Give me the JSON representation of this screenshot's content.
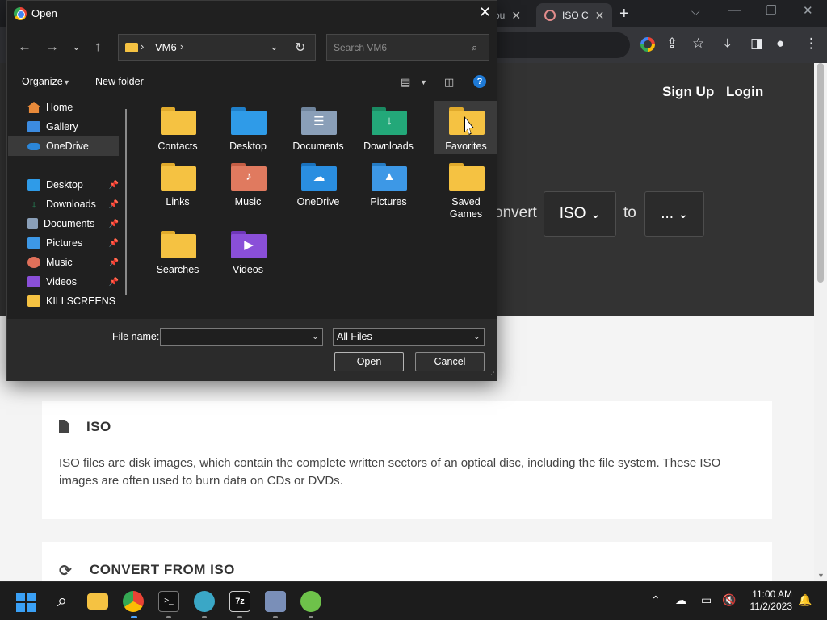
{
  "browser": {
    "tabs": [
      {
        "title": "ou"
      },
      {
        "title": "ISO C"
      }
    ],
    "site": {
      "signup": "Sign Up",
      "login": "Login",
      "convert_word": "onvert",
      "from_format": "ISO",
      "to_word": "to",
      "to_format": "..."
    },
    "cards": [
      {
        "title": "ISO",
        "text": "ISO files are disk images, which contain the complete written sectors of an optical disc, including the file system. These ISO images are often used to burn data on CDs or DVDs."
      },
      {
        "title": "CONVERT FROM ISO"
      }
    ]
  },
  "dialog": {
    "title": "Open",
    "address": {
      "segment": "VM6"
    },
    "search_placeholder": "Search VM6",
    "commands": {
      "organize": "Organize",
      "new_folder": "New folder"
    },
    "nav": [
      {
        "label": "Home",
        "icon": "home-icon",
        "color": "#e88a3a",
        "pinned": false,
        "selected": false
      },
      {
        "label": "Gallery",
        "icon": "gallery-icon",
        "color": "#3c8be0",
        "pinned": false,
        "selected": false
      },
      {
        "label": "OneDrive",
        "icon": "onedrive-icon",
        "color": "#2b86d9",
        "pinned": false,
        "selected": true
      },
      {
        "label": "Desktop",
        "icon": "desktop-icon",
        "color": "#2f9be8",
        "pinned": true,
        "selected": false
      },
      {
        "label": "Downloads",
        "icon": "downloads-icon",
        "color": "#28a86b",
        "pinned": true,
        "selected": false
      },
      {
        "label": "Documents",
        "icon": "documents-icon",
        "color": "#8a9fb8",
        "pinned": true,
        "selected": false
      },
      {
        "label": "Pictures",
        "icon": "pictures-icon",
        "color": "#3d98e6",
        "pinned": true,
        "selected": false
      },
      {
        "label": "Music",
        "icon": "music-icon",
        "color": "#e0705a",
        "pinned": true,
        "selected": false
      },
      {
        "label": "Videos",
        "icon": "videos-icon",
        "color": "#8a4fd8",
        "pinned": true,
        "selected": false
      },
      {
        "label": "KILLSCREENS",
        "icon": "folder-icon",
        "color": "#f5c242",
        "pinned": false,
        "selected": false
      }
    ],
    "files": [
      {
        "label": "Contacts",
        "icon": "contacts-folder-icon",
        "color": "#f5c242",
        "glyph": ""
      },
      {
        "label": "Desktop",
        "icon": "desktop-folder-icon",
        "color": "#2f9be8",
        "glyph": ""
      },
      {
        "label": "Documents",
        "icon": "documents-folder-icon",
        "color": "#8a9fb8",
        "glyph": "☰"
      },
      {
        "label": "Downloads",
        "icon": "downloads-folder-icon",
        "color": "#23a879",
        "glyph": "↓"
      },
      {
        "label": "Favorites",
        "icon": "favorites-folder-icon",
        "color": "#f5c242",
        "glyph": ""
      },
      {
        "label": "Links",
        "icon": "links-folder-icon",
        "color": "#f5c242",
        "glyph": ""
      },
      {
        "label": "Music",
        "icon": "music-folder-icon",
        "color": "#e07a5f",
        "glyph": "♪"
      },
      {
        "label": "OneDrive",
        "icon": "onedrive-folder-icon",
        "color": "#2a8ee0",
        "glyph": "☁"
      },
      {
        "label": "Pictures",
        "icon": "pictures-folder-icon",
        "color": "#3d98e6",
        "glyph": "▲"
      },
      {
        "label": "Saved Games",
        "icon": "saved-games-folder-icon",
        "color": "#f5c242",
        "glyph": ""
      },
      {
        "label": "Searches",
        "icon": "searches-folder-icon",
        "color": "#f5c242",
        "glyph": ""
      },
      {
        "label": "Videos",
        "icon": "videos-folder-icon",
        "color": "#8a4fd8",
        "glyph": "▶"
      }
    ],
    "file_name_label": "File name:",
    "file_name_value": "",
    "filter": "All Files",
    "open_button": "Open",
    "cancel_button": "Cancel"
  },
  "taskbar": {
    "time": "11:00 AM",
    "date": "11/2/2023"
  }
}
